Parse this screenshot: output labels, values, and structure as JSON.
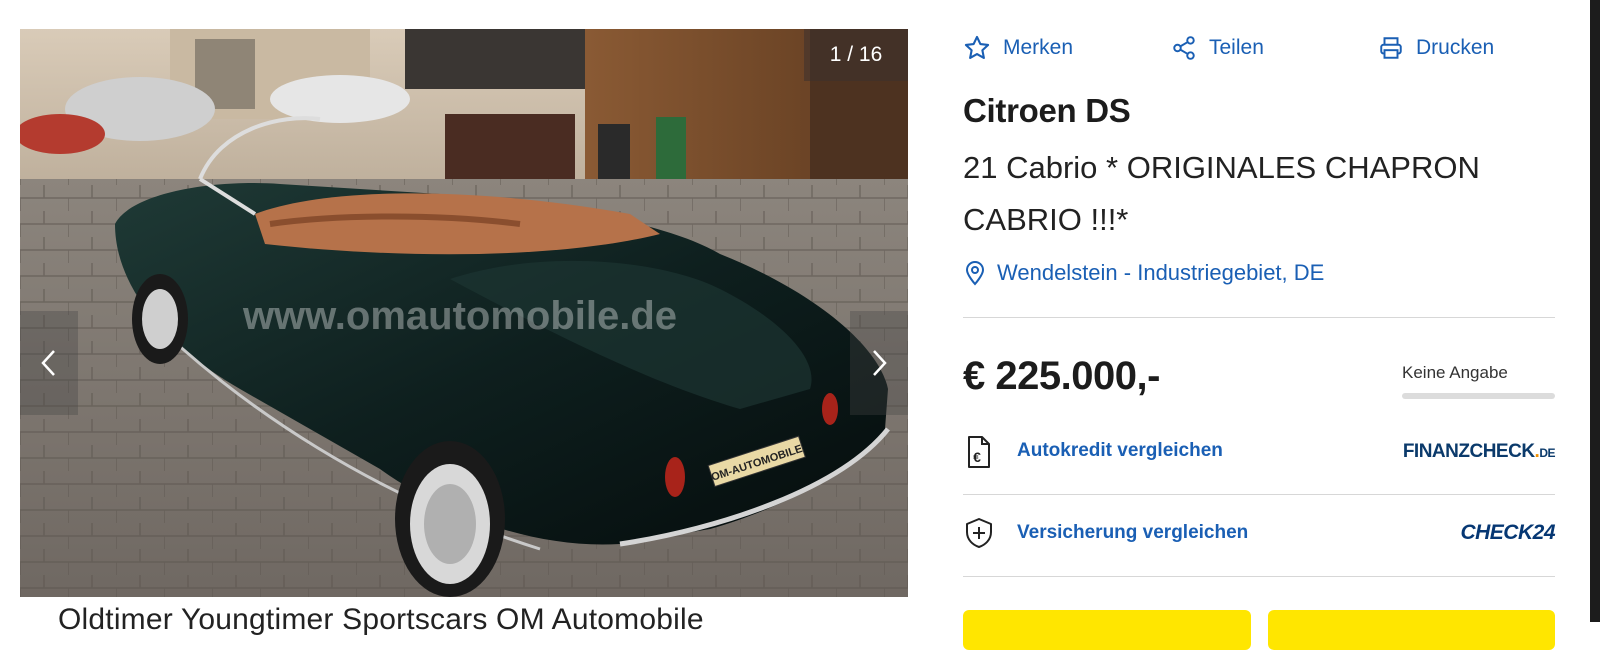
{
  "gallery": {
    "counter": "1 / 16",
    "watermark": "www.omautomobile.de",
    "plate_text": "OM-AUTOMOBILE",
    "prev_icon": "chevron-left-icon",
    "next_icon": "chevron-right-icon"
  },
  "caption": "Oldtimer Youngtimer Sportscars OM Automobile",
  "actions": {
    "merken": "Merken",
    "teilen": "Teilen",
    "drucken": "Drucken"
  },
  "listing": {
    "title": "Citroen DS",
    "subtitle": "21 Cabrio * ORIGINALES CHAPRON CABRIO !!!*",
    "location": "Wendelstein - Industriegebiet, DE",
    "price": "€ 225.000,-",
    "price_rating": "Keine Angabe"
  },
  "offers": {
    "credit_label": "Autokredit vergleichen",
    "credit_brand_main": "FINANZCHECK",
    "credit_brand_dot": ".",
    "credit_brand_tld": "DE",
    "insurance_label": "Versicherung vergleichen",
    "insurance_brand": "CHECK24"
  },
  "colors": {
    "link_blue": "#1a5fb4",
    "cta_yellow": "#ffe600",
    "brand_navy": "#0b3a6b",
    "brand_orange": "#f29100"
  }
}
